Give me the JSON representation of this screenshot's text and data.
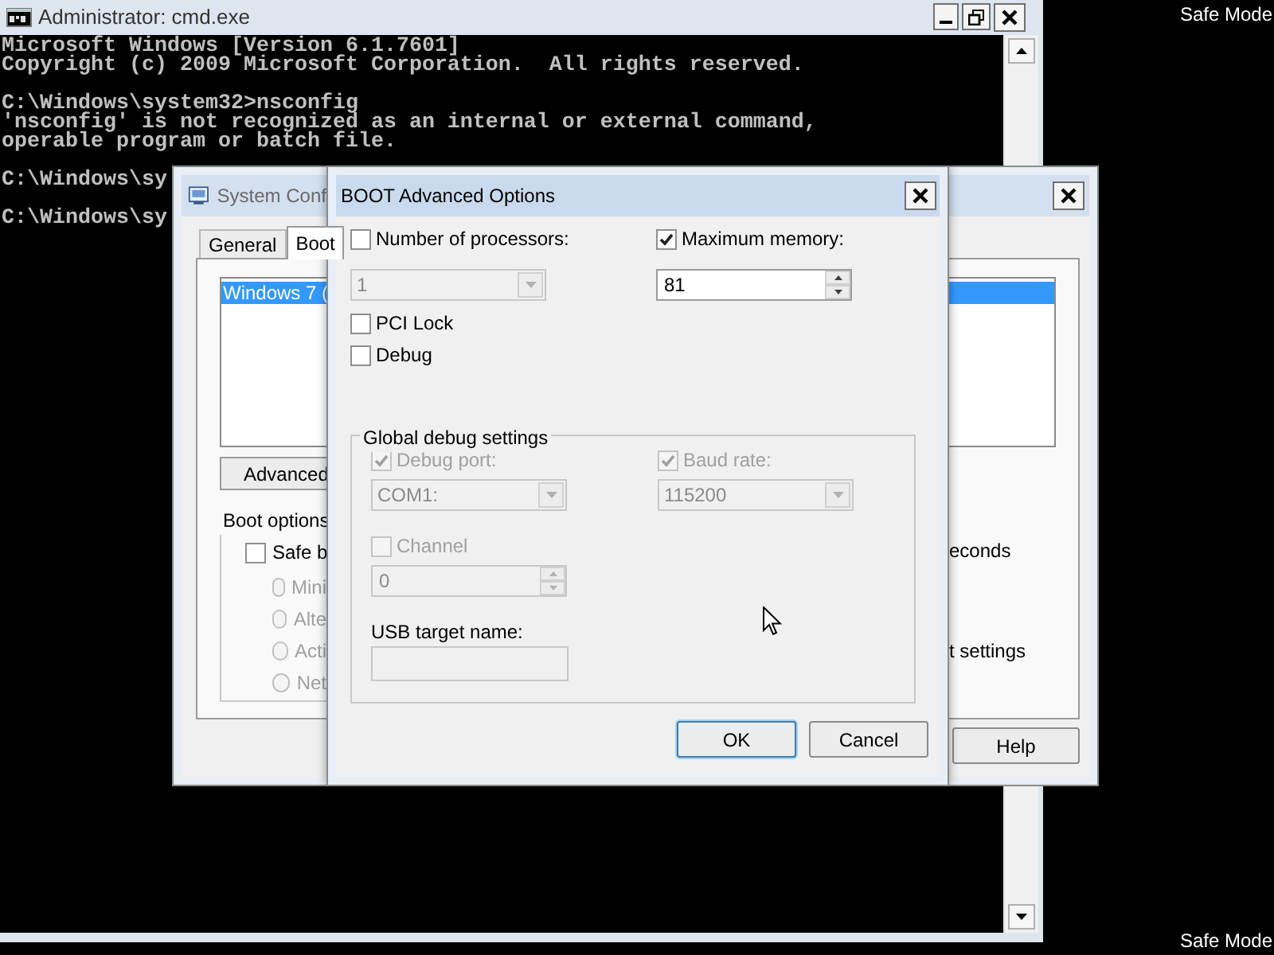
{
  "desktop": {
    "labels": [
      "Safe Mode",
      "Safe Mode"
    ]
  },
  "console_window": {
    "title": "Administrator: cmd.exe",
    "blocks": [
      [
        "Microsoft Windows [Version 6.1.7601]",
        "Copyright (c) 2009 Microsoft Corporation.  All rights reserved."
      ],
      [
        "C:\\Windows\\system32>nsconfig",
        "'nsconfig' is not recognized as an internal or external command,",
        "operable program or batch file."
      ],
      [
        "C:\\Windows\\sy"
      ],
      [
        "C:\\Windows\\sy"
      ]
    ]
  },
  "system_configuration": {
    "title": "System Conf",
    "tabs": [
      {
        "label": "General",
        "selected": false
      },
      {
        "label": "Boot",
        "selected": true
      }
    ],
    "boot_entries": [
      {
        "label": "Windows 7 (",
        "selected": true
      }
    ],
    "advanced_button": "Advanced",
    "boot_options": {
      "title": "Boot options",
      "safe_boot": {
        "label": "Safe b",
        "checked": false
      },
      "modes": [
        {
          "label": "Mini",
          "selected": false
        },
        {
          "label": "Alte",
          "selected": false
        },
        {
          "label": "Acti",
          "selected": false
        },
        {
          "label": "Net",
          "selected": false
        }
      ]
    },
    "fragments": [
      "econds",
      "t settings"
    ],
    "help_button": "Help"
  },
  "dialog": {
    "title": "BOOT Advanced Options",
    "number_of_processors": {
      "label": "Number of processors:",
      "checked": false,
      "value": "1"
    },
    "maximum_memory": {
      "label": "Maximum memory:",
      "checked": true,
      "value": "81"
    },
    "pci_lock": {
      "label": "PCI Lock",
      "checked": false
    },
    "debug": {
      "label": "Debug",
      "checked": false
    },
    "global_debug": {
      "title": "Global debug settings",
      "debug_port": {
        "label": "Debug port:",
        "checked": true,
        "disabled": true,
        "value": "COM1:"
      },
      "baud_rate": {
        "label": "Baud rate:",
        "checked": true,
        "disabled": true,
        "value": "115200"
      },
      "channel": {
        "label": "Channel",
        "checked": false,
        "disabled": true,
        "value": "0"
      },
      "usb_target": {
        "label": "USB target name:",
        "disabled": true
      }
    },
    "buttons": [
      "OK",
      "Cancel"
    ]
  }
}
